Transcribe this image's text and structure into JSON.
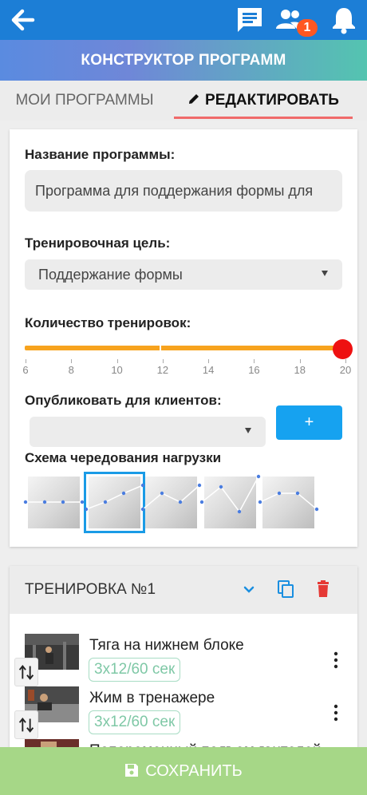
{
  "header": {
    "title": "КОНСТРУКТОР ПРОГРАММ",
    "notification_badge": "1",
    "icons": [
      "back-arrow-icon",
      "chat-icon",
      "people-icon",
      "bell-icon"
    ]
  },
  "tabs": [
    {
      "label": "МОИ ПРОГРАММЫ",
      "active": false
    },
    {
      "label": "РЕДАКТИРОВАТЬ",
      "active": true,
      "icon": "pencil-icon"
    }
  ],
  "form": {
    "name_label": "Название программы:",
    "name_value": "Программа для поддержания формы для",
    "goal_label": "Тренировочная цель:",
    "goal_value": "Поддержание формы",
    "count_label": "Количество тренировок:",
    "count_value": 20,
    "count_ticks": [
      "6",
      "8",
      "10",
      "12",
      "14",
      "16",
      "18",
      "20"
    ],
    "publish_label": "Опубликовать для клиентов:",
    "publish_value": "",
    "add_button": "+",
    "scheme_label": "Схема чередования нагрузки",
    "selected_scheme": 2
  },
  "workout": {
    "title": "ТРЕНИРОВКА №1",
    "icons": [
      "chevron-down-icon",
      "copy-icon",
      "trash-icon"
    ],
    "exercises": [
      {
        "name": "Тяга на нижнем блоке",
        "sets": "3x12/60 сек"
      },
      {
        "name": "Жим в тренажере",
        "sets": "3x12/60 сек"
      },
      {
        "name": "Попеременный подъем гантелей",
        "sets": ""
      }
    ]
  },
  "save": {
    "label": "СОХРАНИТЬ"
  },
  "colors": {
    "topbar": "#1c7ed6",
    "slider": "#f7a31e",
    "thumb": "#ee1111",
    "accent": "#16a2f0",
    "save": "#a6d787",
    "tab_underline": "#f06a6a",
    "delete": "#e53935"
  }
}
